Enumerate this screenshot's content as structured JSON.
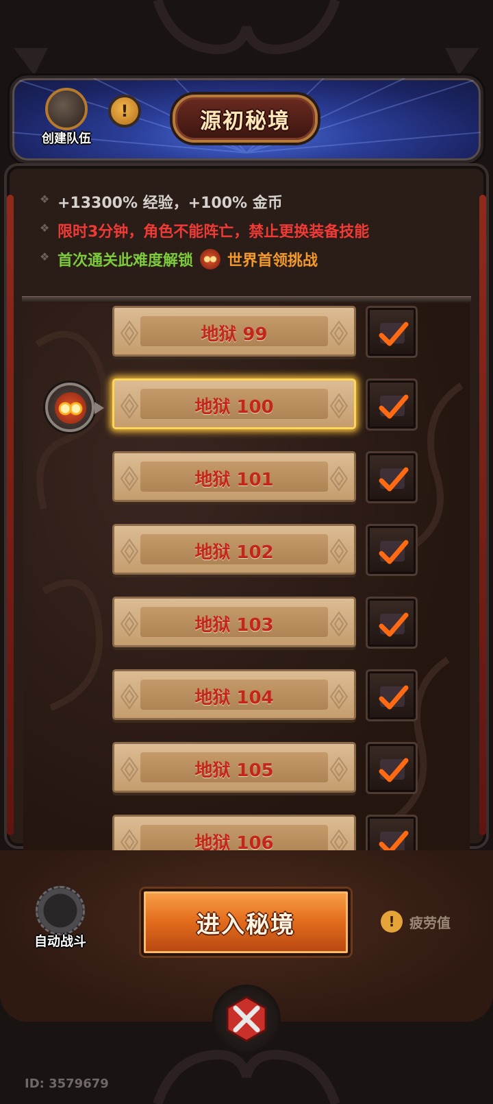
{
  "header": {
    "title": "源初秘境",
    "team_label": "创建队伍",
    "info_icon": "exclamation-icon"
  },
  "info": {
    "line1": "+13300% 经验，+100% 金币",
    "line2": "限时3分钟，角色不能阵亡，禁止更换装备技能",
    "line3_prefix": "首次通关此难度解锁",
    "line3_suffix": "世界首领挑战"
  },
  "levels": [
    {
      "label": "地狱 99",
      "selected": false
    },
    {
      "label": "地狱 100",
      "selected": true
    },
    {
      "label": "地狱 101",
      "selected": false
    },
    {
      "label": "地狱 102",
      "selected": false
    },
    {
      "label": "地狱 103",
      "selected": false
    },
    {
      "label": "地狱 104",
      "selected": false
    },
    {
      "label": "地狱 105",
      "selected": false
    },
    {
      "label": "地狱 106",
      "selected": false
    }
  ],
  "bottom": {
    "auto_battle_label": "自动战斗",
    "enter_label": "进入秘境",
    "fatigue_label": "疲劳值",
    "fatigue_icon": "!"
  },
  "footer": {
    "id_text": "ID: 3579679"
  },
  "colors": {
    "level_text": "#c3261a",
    "check": "#ff6a12",
    "enter_button": "#e56f1e",
    "info_red": "#ef3a36",
    "info_green": "#7ccb3c",
    "info_orange": "#f39a2a"
  }
}
